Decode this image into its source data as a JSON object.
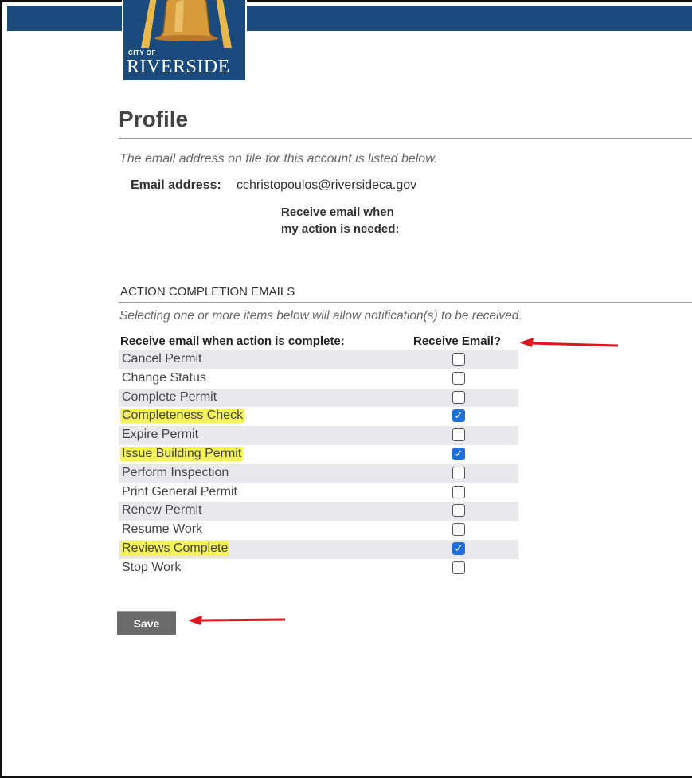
{
  "header": {
    "logo_small": "CITY OF",
    "logo_name": "RIVERSIDE"
  },
  "page": {
    "title": "Profile",
    "intro": "The email address on file for this account is listed below.",
    "email_label": "Email address:",
    "email_value": "cchristopoulos@riversideca.gov",
    "action_needed_label": "Receive email when my action is needed:"
  },
  "completion": {
    "heading": "ACTION COMPLETION EMAILS",
    "note": "Selecting one or more items below will allow notification(s) to be received.",
    "col_action": "Receive email when action is complete:",
    "col_email": "Receive Email?",
    "items": [
      {
        "label": "Cancel Permit",
        "checked": false,
        "highlight": false
      },
      {
        "label": "Change Status",
        "checked": false,
        "highlight": false
      },
      {
        "label": "Complete Permit",
        "checked": false,
        "highlight": false
      },
      {
        "label": "Completeness Check",
        "checked": true,
        "highlight": true
      },
      {
        "label": "Expire Permit",
        "checked": false,
        "highlight": false
      },
      {
        "label": "Issue Building Permit",
        "checked": true,
        "highlight": true
      },
      {
        "label": "Perform Inspection",
        "checked": false,
        "highlight": false
      },
      {
        "label": "Print General Permit",
        "checked": false,
        "highlight": false
      },
      {
        "label": "Renew Permit",
        "checked": false,
        "highlight": false
      },
      {
        "label": "Resume Work",
        "checked": false,
        "highlight": false
      },
      {
        "label": "Reviews Complete",
        "checked": true,
        "highlight": true
      },
      {
        "label": "Stop Work",
        "checked": false,
        "highlight": false
      }
    ]
  },
  "actions": {
    "save_label": "Save"
  },
  "colors": {
    "header_bg": "#1b4a7c",
    "highlight": "#f4f45a",
    "annotation_arrow": "#e0141e",
    "checkbox_checked": "#1e6fd9",
    "save_bg": "#6b6b6b"
  }
}
